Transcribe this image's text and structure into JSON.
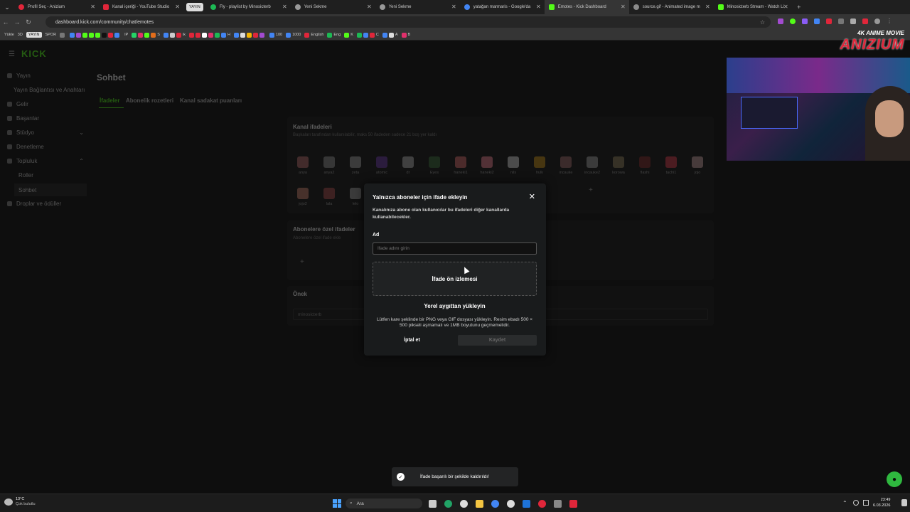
{
  "browser": {
    "tabs": [
      {
        "label": "Profil Seç - Anizium",
        "color": "#e0263a"
      },
      {
        "label": "Kanal içeriği - YouTube Studio",
        "color": "#e0263a"
      },
      {
        "label": "YAYIN",
        "group": true
      },
      {
        "label": "Fly - playlist by Minosicterb",
        "color": "#1db954"
      },
      {
        "label": "Yeni Sekme",
        "color": "#999999"
      },
      {
        "label": "Yeni Sekme",
        "color": "#999999"
      },
      {
        "label": "yatağan marmaris - Google'da",
        "color": "#4285f4"
      },
      {
        "label": "Emotes - Kick Dashboard",
        "color": "#53fc18",
        "active": true
      },
      {
        "label": "source.gif - Animated image m",
        "color": "#8a8a8a"
      },
      {
        "label": "Minosicterb Stream - Watch Li",
        "color": "#53fc18"
      }
    ],
    "url": "dashboard.kick.com/community/chat/emotes",
    "bookmarks": [
      "Yükle",
      "3D",
      "YAYIN",
      "SPOR",
      "IP",
      "S",
      "ik",
      "H",
      "100",
      "1000",
      "English",
      "Eng",
      "K",
      "C",
      "A",
      "B"
    ]
  },
  "sidebar": {
    "items": [
      "Yayın",
      "Yayın Bağlantısı ve Anahtarı",
      "Gelir",
      "Başarılar",
      "Stüdyo",
      "Denetleme",
      "Topluluk",
      "Roller",
      "Sohbet",
      "Droplar ve ödüller"
    ]
  },
  "page": {
    "title": "Sohbet",
    "tabs": [
      "İfadeler",
      "Abonelik rozetleri",
      "Kanal sadakat puanları"
    ],
    "channel_emotes_title": "Kanal ifadeleri",
    "channel_emotes_desc": "Başkaları tarafından kullanılabilir, maks 50 ifadeden sadece 21 boş yer kaldı",
    "emotes": [
      "anya",
      "anya2",
      "zeta",
      "atomic",
      "dr",
      "Eyes",
      "haneki1",
      "haneki2",
      "nils",
      "hulk",
      "incauke",
      "incauke2",
      "korowa",
      "flashi",
      "tachi1",
      "jojo",
      "jojo2",
      "lala",
      "lelo",
      "zero"
    ],
    "subscriber_emotes_title": "Abonelere özel ifadeler",
    "subscriber_emotes_desc": "Abonelere özel ifade ekle",
    "prefix_title": "Önek",
    "prefix_value": "minosicterb"
  },
  "modal": {
    "title": "Yalnızca aboneler için ifade ekleyin",
    "description": "Kanalınıza abone olan kullanıcılar bu ifadeleri diğer kanallarda kullanabilecekler.",
    "name_label": "Ad",
    "name_placeholder": "İfade adını girin",
    "preview_label": "İfade ön izlemesi",
    "upload_label": "Yerel aygıttan yükleyin",
    "hint": "Lütfen kare şeklinde bir PNG veya GIF dosyası yükleyin. Resim ebadı 500 × 500 pikseli aşmamalı ve 1MB boyutunu geçmemelidir.",
    "cancel_label": "İptal et",
    "save_label": "Kaydet"
  },
  "toast": {
    "message": "İfade başarılı bir şekilde kaldırıldı!"
  },
  "overlay": {
    "logo_top": "4K ANIME MOVIE",
    "logo_main": "ANIZIUM"
  },
  "taskbar": {
    "weather_temp": "13°C",
    "weather_desc": "Çok bulutlu",
    "search_label": "Ara",
    "time": "23:49",
    "date": "6.03.2026"
  },
  "colors": {
    "accent": "#53fc18",
    "toast_check": "#ffffff"
  }
}
